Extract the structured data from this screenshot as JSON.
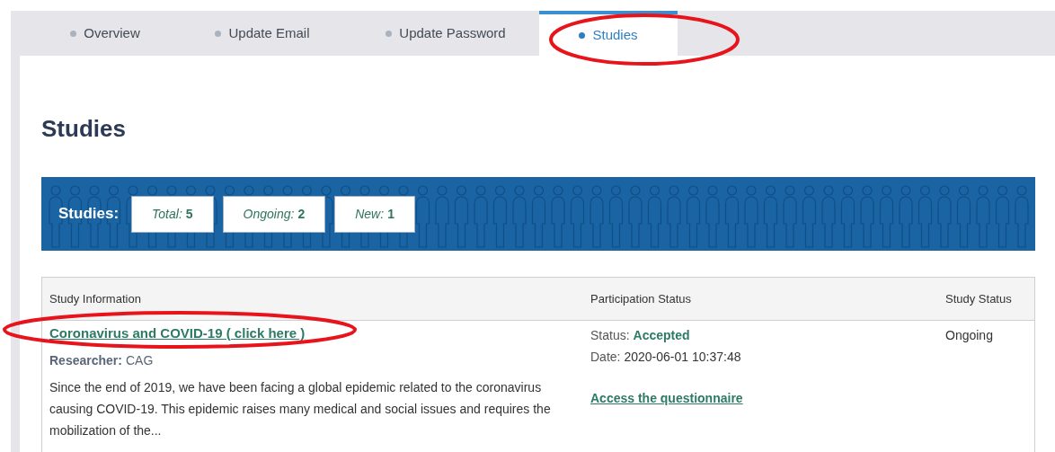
{
  "tabs": [
    {
      "label": "Overview",
      "selected": false
    },
    {
      "label": "Update Email",
      "selected": false
    },
    {
      "label": "Update Password",
      "selected": false
    },
    {
      "label": "Studies",
      "selected": true
    }
  ],
  "heading": "Studies",
  "summary": {
    "label": "Studies:",
    "counts": [
      {
        "label": "Total:",
        "value": "5"
      },
      {
        "label": "Ongoing:",
        "value": "2"
      },
      {
        "label": "New:",
        "value": "1"
      }
    ]
  },
  "table": {
    "columns": [
      "Study Information",
      "Participation Status",
      "Study Status"
    ],
    "rows": [
      {
        "title": "Coronavirus and COVID-19 ( click here )",
        "researcher_label": "Researcher:",
        "researcher": "CAG",
        "description": "Since the end of 2019, we have been facing a global epidemic related to the coronavirus causing COVID-19. This epidemic raises many medical and social issues and requires the mobilization of the...",
        "status_label": "Status:",
        "status": "Accepted",
        "date_label": "Date:",
        "date": "2020-06-01 10:37:48",
        "action": "Access the questionnaire",
        "study_status": "Ongoing"
      }
    ]
  }
}
